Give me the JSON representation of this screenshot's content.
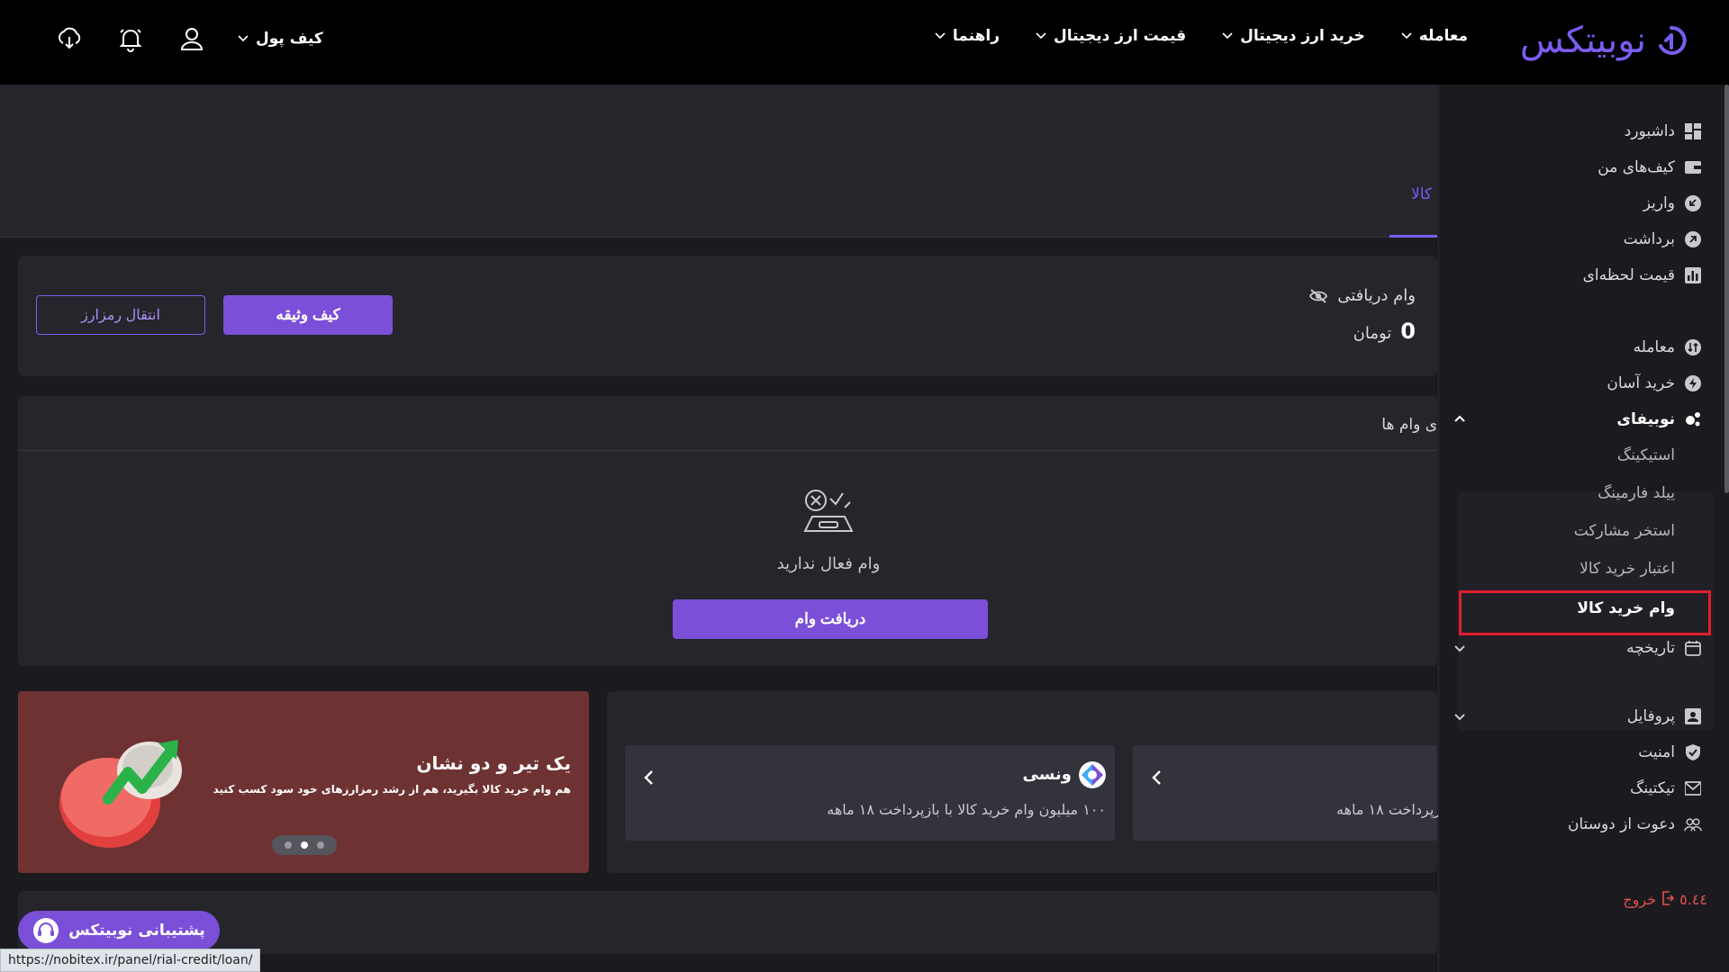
{
  "brand": {
    "name": "نوبیتکس",
    "color": "#7b5cf0"
  },
  "nav": {
    "items": [
      {
        "label": "معامله"
      },
      {
        "label": "خرید ارز دیجیتال"
      },
      {
        "label": "قیمت ارز دیجیتال"
      },
      {
        "label": "راهنما"
      }
    ],
    "wallet_label": "کیف پول"
  },
  "sidebar": {
    "dashboard": "داشبورد",
    "my_wallets": "کیف‌های من",
    "deposit": "واریز",
    "withdraw": "برداشت",
    "live_price": "قیمت لحظه‌ای",
    "trade": "معامله",
    "easy_buy": "خرید آسان",
    "nobifi": "نوبیفای",
    "staking": "استیکینگ",
    "yield_farming": "ییلد فارمینگ",
    "pool": "استخر مشارکت",
    "goods_credit": "اعتبار خرید کالا",
    "goods_loan": "وام خرید کالا",
    "history": "تاریخچه",
    "profile": "پروفایل",
    "security": "امنیت",
    "ticketing": "تیکتینگ",
    "invite": "دعوت از دوستان",
    "logout": "خروج",
    "logout_prefix": "‎٥.٤٤‎"
  },
  "tabs": {
    "active": "کالا"
  },
  "loan_summary": {
    "label": "وام دریافتی",
    "amount": "0",
    "currency": "تومان",
    "collateral_button": "کیف وثیقه",
    "transfer_button": "انتقال رمزارز"
  },
  "loans": {
    "title": "ی وام ها",
    "empty_text": "وام فعال ندارید",
    "get_loan_button": "دریافت وام"
  },
  "promo": {
    "title": "یک تیر و دو نشان",
    "subtitle": "هم وام خرید کالا بگیرید، هم از رشد رمزارزهای خود سود کسب کنید",
    "background": "#6e3232"
  },
  "offers": [
    {
      "name": "ونسی",
      "desc": "۱۰۰ میلیون وام خرید کالا با بازپرداخت ۱۸ ماهه"
    },
    {
      "name": "",
      "desc": "زپرداخت ۱۸ ماهه"
    }
  ],
  "support": {
    "label": "پشتیبانی نوبیتکس"
  },
  "status_bar": {
    "url": "https://nobitex.ir/panel/rial-credit/loan/"
  }
}
